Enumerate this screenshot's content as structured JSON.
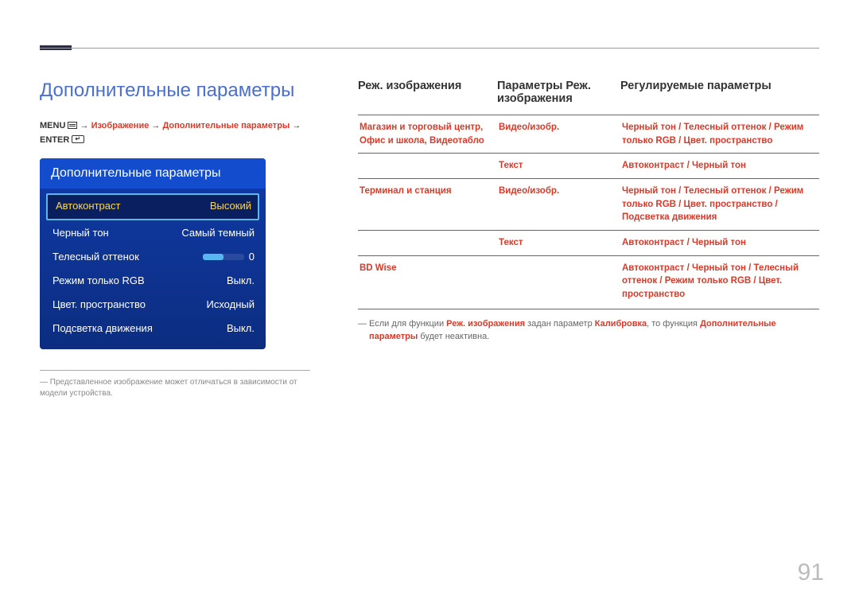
{
  "page": {
    "title": "Дополнительные параметры",
    "number": "91"
  },
  "breadcrumb": {
    "menu": "MENU",
    "arrow": "→",
    "image": "Изображение",
    "advanced": "Дополнительные параметры",
    "enter": "ENTER"
  },
  "osd": {
    "title": "Дополнительные параметры",
    "rows": [
      {
        "label": "Автоконтраст",
        "value": "Высокий"
      },
      {
        "label": "Черный тон",
        "value": "Самый темный"
      },
      {
        "label": "Телесный оттенок",
        "value": "0"
      },
      {
        "label": "Режим только RGB",
        "value": "Выкл."
      },
      {
        "label": "Цвет. пространство",
        "value": "Исходный"
      },
      {
        "label": "Подсветка движения",
        "value": "Выкл."
      }
    ]
  },
  "disclaimer": "Представленное изображение может отличаться в зависимости от модели устройства.",
  "table": {
    "headers": {
      "c1": "Реж. изображения",
      "c2": "Параметры Реж. изображения",
      "c3": "Регулируемые параметры"
    },
    "rows": [
      {
        "c1": "Магазин и торговый центр, Офис и школа, Видеотабло",
        "c2": "Видео/изобр.",
        "c3": "Черный тон / Телесный оттенок / Режим только RGB / Цвет. пространство"
      },
      {
        "c1": "",
        "c2": "Текст",
        "c3": "Автоконтраст / Черный тон"
      },
      {
        "c1": "Терминал и станция",
        "c2": "Видео/изобр.",
        "c3": "Черный тон / Телесный оттенок / Режим только RGB / Цвет. пространство / Подсветка движения"
      },
      {
        "c1": "",
        "c2": "Текст",
        "c3": "Автоконтраст / Черный тон"
      },
      {
        "c1": "BD Wise",
        "c2": "",
        "c3": "Автоконтраст / Черный тон / Телесный оттенок / Режим только RGB / Цвет. пространство"
      }
    ]
  },
  "note": {
    "prefix": "Если для функции ",
    "hl1": "Реж. изображения",
    "mid1": " задан параметр ",
    "hl2": "Калибровка",
    "mid2": ", то функция ",
    "hl3": "Дополнительные параметры",
    "suffix": " будет неактивна."
  }
}
